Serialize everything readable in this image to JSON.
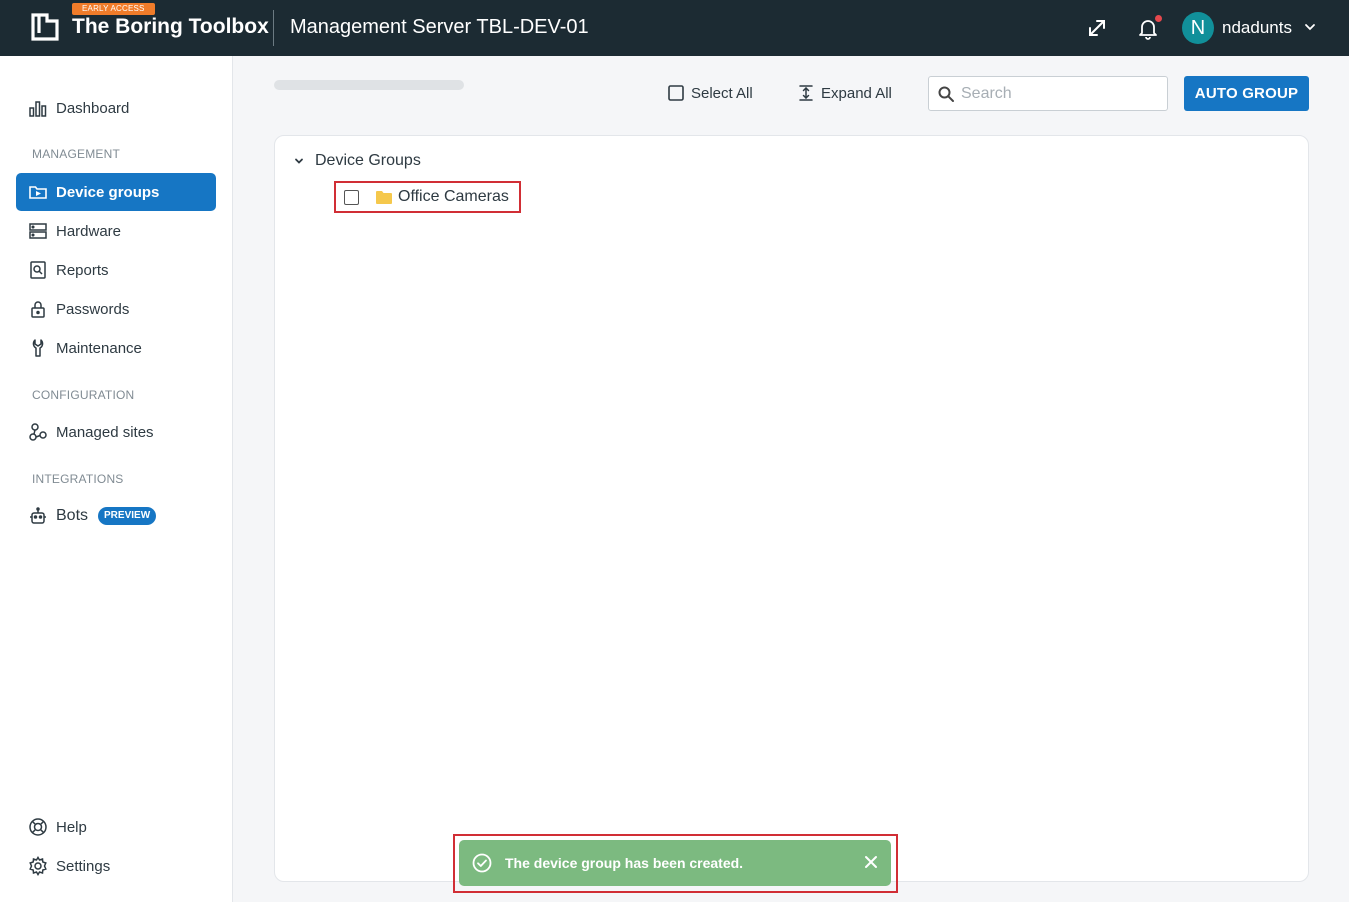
{
  "header": {
    "badge": "EARLY ACCESS",
    "brand": "The Boring Toolbox",
    "server_title": "Management Server TBL-DEV-01",
    "avatar_initial": "N",
    "username": "ndadunts"
  },
  "sidebar": {
    "dashboard": "Dashboard",
    "section_management": "MANAGEMENT",
    "device_groups": "Device groups",
    "hardware": "Hardware",
    "reports": "Reports",
    "passwords": "Passwords",
    "maintenance": "Maintenance",
    "section_configuration": "CONFIGURATION",
    "managed_sites": "Managed sites",
    "section_integrations": "INTEGRATIONS",
    "bots": "Bots",
    "bots_badge": "PREVIEW",
    "help": "Help",
    "settings": "Settings"
  },
  "toolbar": {
    "select_all": "Select All",
    "expand_all": "Expand All",
    "search_placeholder": "Search",
    "auto_group": "AUTO GROUP"
  },
  "tree": {
    "root_label": "Device Groups",
    "items": [
      {
        "label": "Office Cameras"
      }
    ]
  },
  "toast": {
    "message": "The device group has been created."
  },
  "colors": {
    "topbar": "#1c2b33",
    "accent": "#1676c4",
    "badge_orange": "#f07c2a",
    "toast_green": "#7cba80",
    "highlight_red": "#d12e35"
  }
}
